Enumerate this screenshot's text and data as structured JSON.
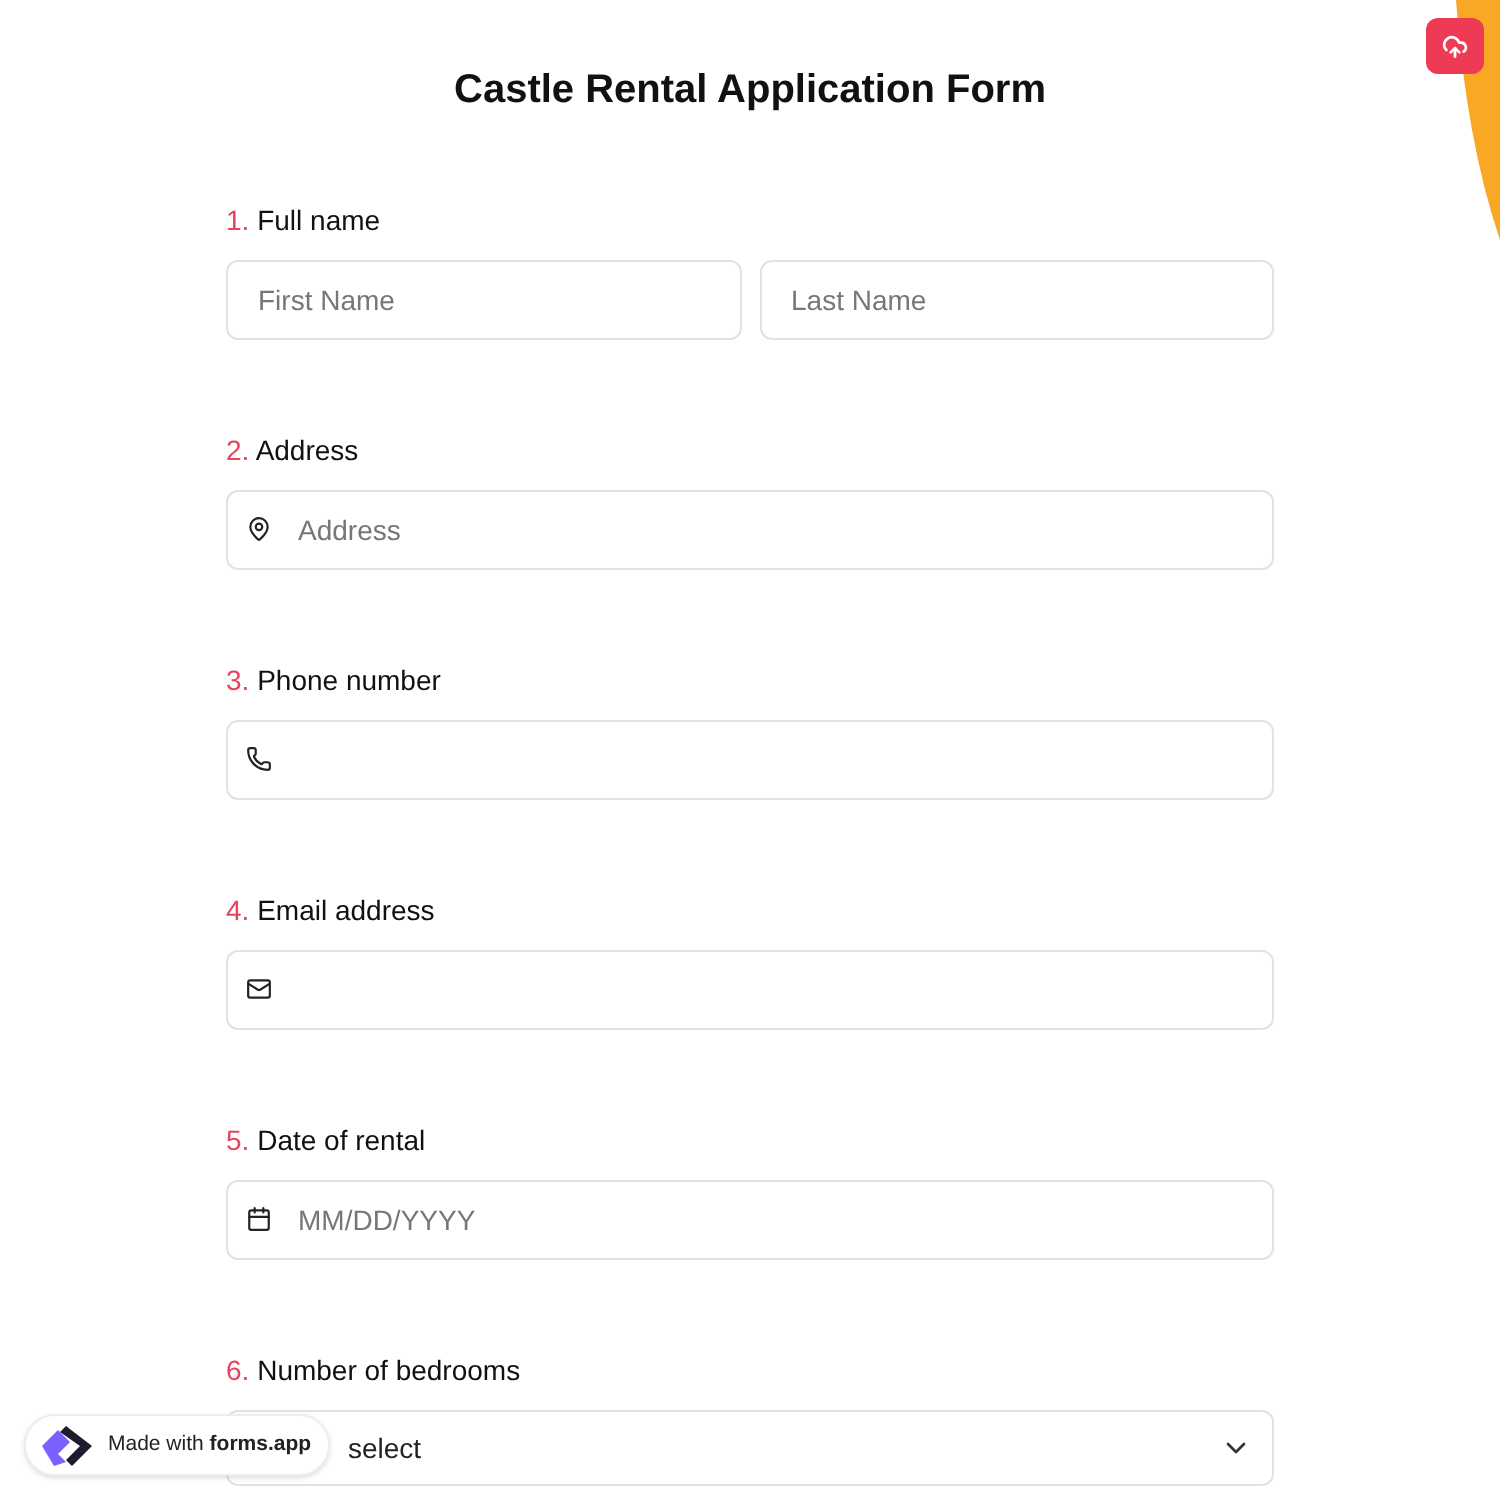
{
  "title": "Castle Rental Application Form",
  "questions": [
    {
      "number": "1.",
      "label": "Full name",
      "kind": "name",
      "fields": [
        {
          "placeholder": "First Name"
        },
        {
          "placeholder": "Last Name"
        }
      ]
    },
    {
      "number": "2.",
      "label": "Address",
      "kind": "address",
      "placeholder": "Address"
    },
    {
      "number": "3.",
      "label": "Phone number",
      "kind": "phone"
    },
    {
      "number": "4.",
      "label": "Email address",
      "kind": "email"
    },
    {
      "number": "5.",
      "label": "Date of rental",
      "kind": "date",
      "placeholder": "MM/DD/YYYY"
    },
    {
      "number": "6.",
      "label": "Number of bedrooms",
      "kind": "select",
      "value": "select"
    }
  ],
  "badge": {
    "prefix": "Made with",
    "brand": "forms.app"
  }
}
